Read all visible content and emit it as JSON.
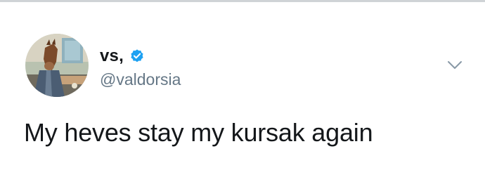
{
  "tweet": {
    "author": {
      "display_name": "vs,",
      "handle": "@valdorsia",
      "verified": true,
      "avatar_icon": "cartoon-horse-avatar"
    },
    "text": "My heves stay my kursak again",
    "menu_icon": "chevron-down-icon"
  },
  "colors": {
    "verified_blue": "#1da1f2",
    "handle_gray": "#657786",
    "text_dark": "#14171a"
  }
}
